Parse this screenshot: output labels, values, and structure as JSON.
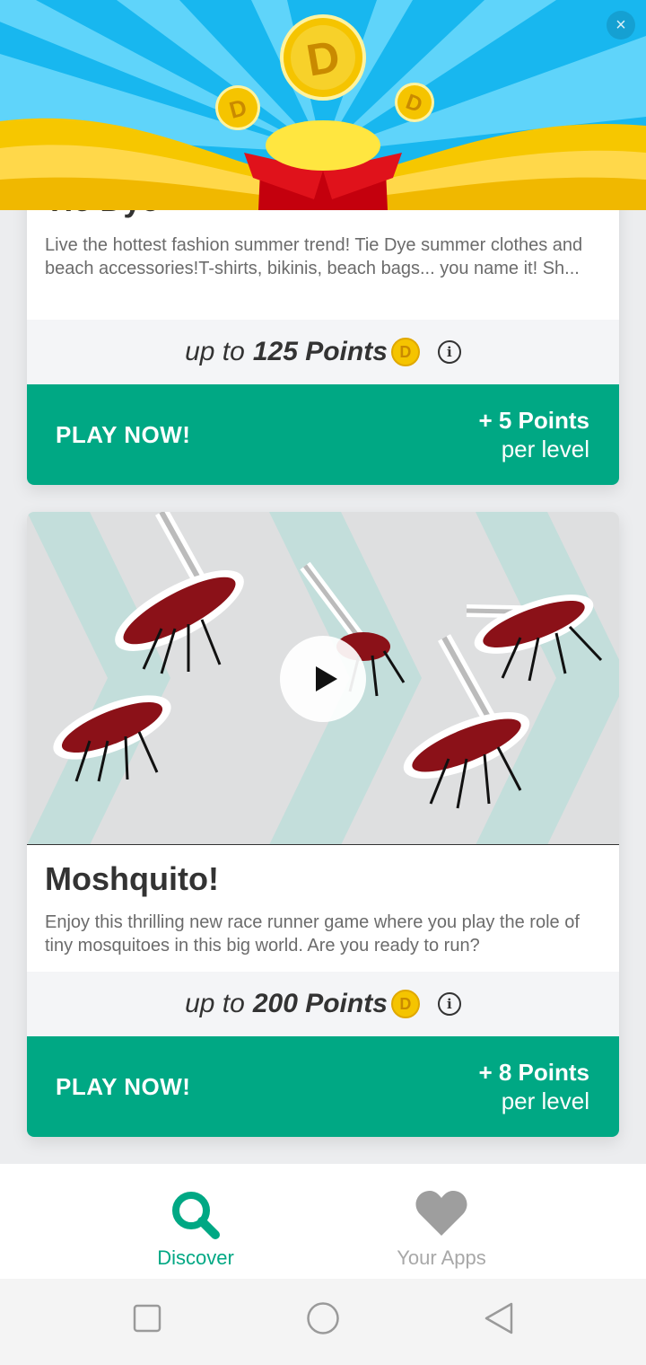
{
  "header": {
    "close_label": "×",
    "coin_letter": "D"
  },
  "cards": [
    {
      "title": "Tie Dye",
      "description": "Live the hottest fashion summer trend! Tie Dye summer clothes and beach accessories!T-shirts, bikinis, beach bags... you name it! Sh...",
      "points_prefix": "up to",
      "points_value": "125 Points",
      "play_label": "PLAY NOW!",
      "per_level_points": "+ 5 Points",
      "per_level_suffix": "per level"
    },
    {
      "title": "Moshquito!",
      "description": "Enjoy this thrilling new race runner game where you play the role of tiny mosquitoes in this big world. Are you ready to run?",
      "points_prefix": "up to",
      "points_value": "200 Points",
      "play_label": "PLAY NOW!",
      "per_level_points": "+ 8 Points",
      "per_level_suffix": "per level"
    }
  ],
  "coin_symbol": "D",
  "info_symbol": "i",
  "bottom_nav": {
    "items": [
      {
        "label": "Discover",
        "icon": "search-icon",
        "active": true
      },
      {
        "label": "Your Apps",
        "icon": "heart-icon",
        "active": false
      }
    ]
  },
  "colors": {
    "accent": "#00a884",
    "banner_sky": "#18b7ef",
    "gold": "#f5c400",
    "gift_red": "#d6101a"
  }
}
